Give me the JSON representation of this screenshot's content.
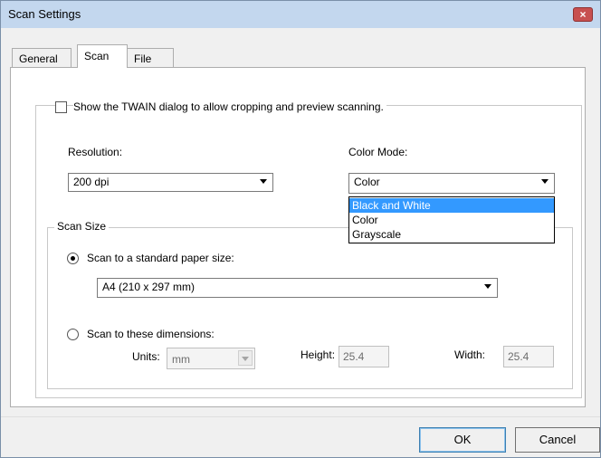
{
  "window": {
    "title": "Scan Settings",
    "close_label": "×"
  },
  "tabs": [
    {
      "label": "General",
      "active": false
    },
    {
      "label": "Scan",
      "active": true
    },
    {
      "label": "File",
      "active": false
    }
  ],
  "twain": {
    "label": "Show the TWAIN dialog to allow cropping and preview scanning.",
    "checked": false
  },
  "resolution": {
    "label": "Resolution:",
    "value": "200 dpi"
  },
  "color_mode": {
    "label": "Color Mode:",
    "value": "Color",
    "options": [
      "Black and White",
      "Color",
      "Grayscale"
    ],
    "highlighted": "Black and White"
  },
  "scan_size": {
    "legend": "Scan Size",
    "standard": {
      "label": "Scan to a standard paper size:",
      "selected": true,
      "value": "A4 (210 x 297 mm)"
    },
    "dimensions": {
      "label": "Scan to these dimensions:",
      "selected": false,
      "units_label": "Units:",
      "units_value": "mm",
      "height_label": "Height:",
      "height_value": "25.4",
      "width_label": "Width:",
      "width_value": "25.4"
    }
  },
  "buttons": {
    "ok": "OK",
    "cancel": "Cancel"
  }
}
